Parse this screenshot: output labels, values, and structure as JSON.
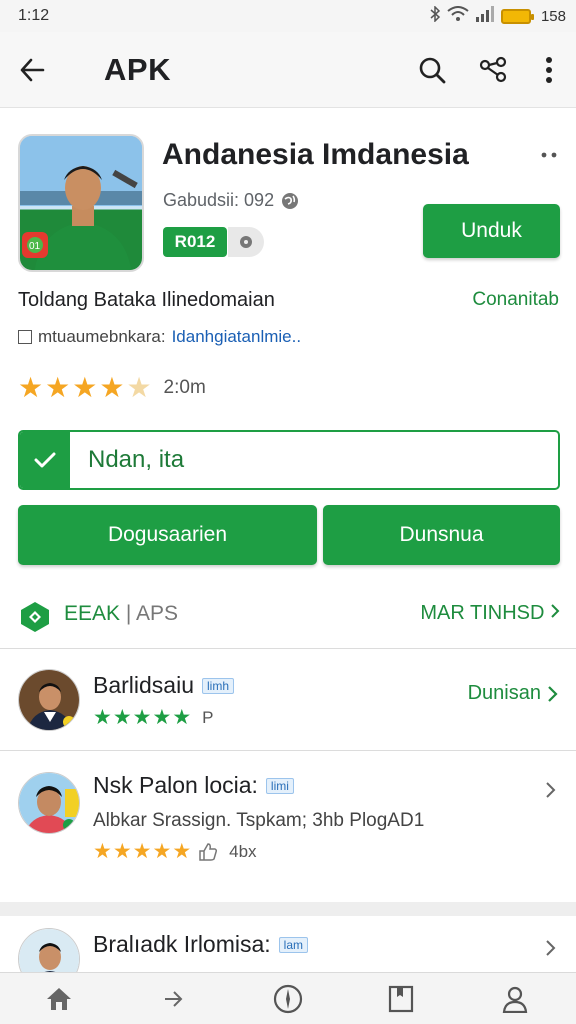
{
  "status_bar": {
    "time": "1:12",
    "battery": "158"
  },
  "app_bar": {
    "title": "APK"
  },
  "app": {
    "name": "Andanesia Imdanesia",
    "meta": "Gabudsii: 092",
    "badge": "R012",
    "install_label": "Unduk",
    "developer": "Toldang Bataka Ilinedomaian",
    "developer_link": "Conanitab",
    "tag_text": "mtuaumebnkara:",
    "tag_link": "Idanhgiatanlmie..",
    "rating_text": "2:0m",
    "rating_value": 4.5
  },
  "check_field": {
    "value": "Ndan, ita"
  },
  "buttons": {
    "primary_left": "Dogusaarien",
    "primary_right": "Dunsnua"
  },
  "section": {
    "brand": "EEAK",
    "separator": "|",
    "category": "APS",
    "more": "MAR TINHSD"
  },
  "list": [
    {
      "title": "Barlidsaiu",
      "badge": "limh",
      "action": "Dunisan",
      "stars": 5,
      "after_stars": "P"
    },
    {
      "title": "Nsk Palon locia:",
      "badge": "limi",
      "subtitle": "Albkar Srassign. Tspkam; 3hb PlogAD1",
      "stars": 4.5,
      "after_stars": "4bx"
    },
    {
      "title": "Bralıadk Irlomisa:",
      "badge": "lam"
    }
  ],
  "colors": {
    "accent": "#1e9e44",
    "star": "#f5a623",
    "link": "#1a5fb4"
  },
  "icons": {
    "back": "arrow-left-icon",
    "search": "search-icon",
    "share": "share-icon",
    "more": "more-vert-icon",
    "nav": [
      "home-icon",
      "send-icon",
      "compass-icon",
      "bookmark-icon",
      "profile-icon"
    ]
  }
}
